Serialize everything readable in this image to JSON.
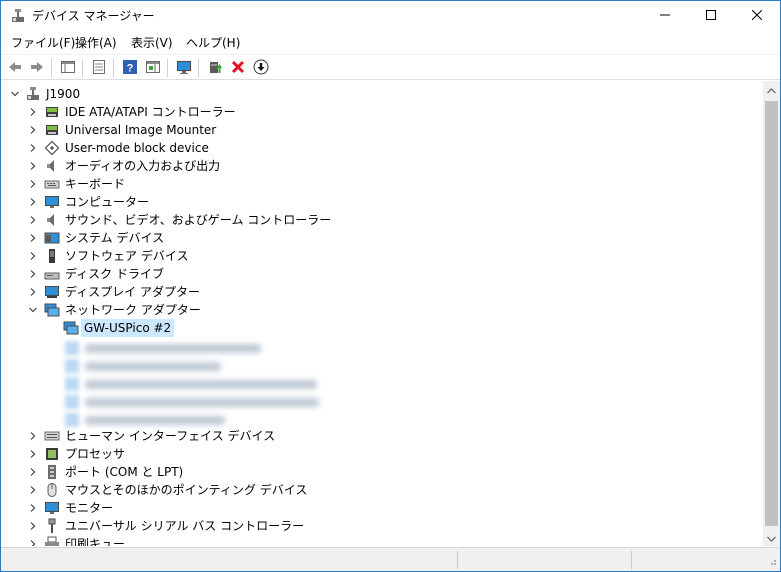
{
  "window": {
    "title": "デバイス マネージャー"
  },
  "menu": {
    "file": "ファイル(F)",
    "action": "操作(A)",
    "view": "表示(V)",
    "help": "ヘルプ(H)"
  },
  "tree": {
    "root": "J1900",
    "categories": [
      "IDE ATA/ATAPI コントローラー",
      "Universal Image Mounter",
      "User-mode block device",
      "オーディオの入力および出力",
      "キーボード",
      "コンピューター",
      "サウンド、ビデオ、およびゲーム コントローラー",
      "システム デバイス",
      "ソフトウェア デバイス",
      "ディスク ドライブ",
      "ディスプレイ アダプター",
      "ネットワーク アダプター"
    ],
    "network_child_selected": "GW-USPico #2",
    "categories_after": [
      "ヒューマン インターフェイス デバイス",
      "プロセッサ",
      "ポート (COM と LPT)",
      "マウスとそのほかのポインティング デバイス",
      "モニター",
      "ユニバーサル シリアル バス コントローラー",
      "印刷キュー"
    ]
  },
  "colors": {
    "selection": "#cce8ff",
    "accent": "#2b79c9",
    "delete_red": "#e81123"
  }
}
